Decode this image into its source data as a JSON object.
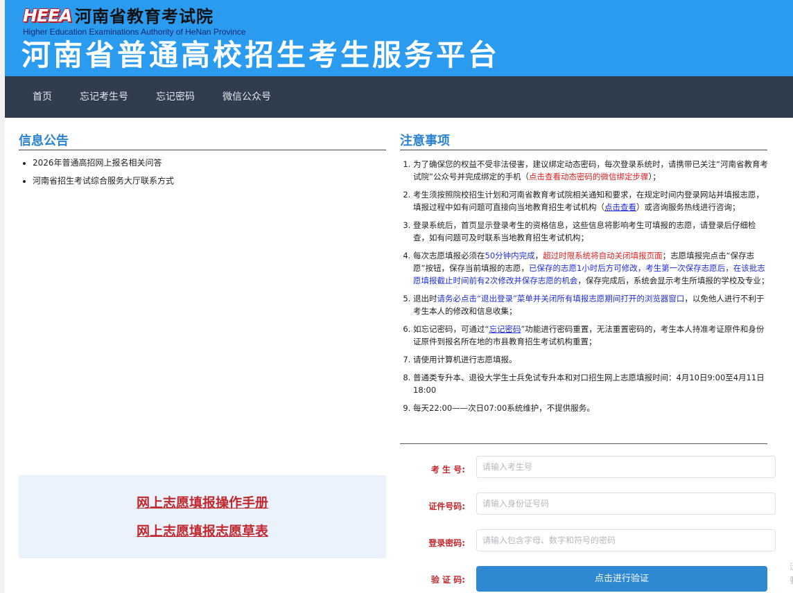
{
  "header": {
    "logo_text": "HEEA",
    "org_name_cn": "河南省教育考试院",
    "org_name_en": "Higher Education Examinations Authority of HeNan Province",
    "platform_title": "河南省普通高校招生考生服务平台"
  },
  "nav": {
    "items": [
      {
        "label": "首页"
      },
      {
        "label": "忘记考生号"
      },
      {
        "label": "忘记密码"
      },
      {
        "label": "微信公众号"
      }
    ]
  },
  "notices": {
    "title": "信息公告",
    "items": [
      {
        "label": "2026年普通高招网上报名相关问答"
      },
      {
        "label": "河南省招生考试综合服务大厅联系方式"
      }
    ]
  },
  "manuals": {
    "link1": "网上志愿填报操作手册",
    "link2": "网上志愿填报志愿草表"
  },
  "rules": {
    "title": "注意事项",
    "r1_a": "为了确保您的权益不受非法侵害，建议绑定动态密码，每次登录系统时，请携带已关注“河南省教育考试院”公众号并完成绑定的手机（",
    "r1_red": "点击查看动态密码的微信绑定步骤",
    "r1_b": "）；",
    "r2_a": "考生须按照院校招生计划和河南省教育考试院相关通知和要求，在规定时间内登录网站并填报志愿，填报过程中如有问题可直接向当地教育招生考试机构（",
    "r2_link": "点击查看",
    "r2_b": "）或咨询服务热线进行咨询；",
    "r3": "登录系统后，首页显示登录考生的资格信息，这些信息将影响考生可填报的志愿，请登录后仔细检查，如有问题可及时联系当地教育招生考试机构；",
    "r4_a": "每次志愿填报必须在",
    "r4_blue1": "50分钟内完成",
    "r4_b": "，",
    "r4_red": "超过时限系统将自动关闭填报页面",
    "r4_c": "；志愿填报完点击“保存志愿”按钮，保存当前填报的志愿，",
    "r4_blue2": "已保存的志愿1小时后方可修改，考生第一次保存志愿后，在该批志愿填报截止时间前有2次修改并保存志愿的机会",
    "r4_d": "，保存完成后，系统会显示考生所填报的学校及专业；",
    "r5_a": "退出时",
    "r5_blue": "请务必点击“退出登录”菜单并关闭所有填报志愿期间打开的浏览器窗口",
    "r5_b": "，以免他人进行不利于考生本人的修改和信息收集；",
    "r6_a": "如忘记密码，可通过“",
    "r6_link": "忘记密码",
    "r6_b": "”功能进行密码重置，无法重置密码的，考生本人持准考证原件和身份证原件到报名所在地的市县教育招生考试机构重置；",
    "r7": "请使用计算机进行志愿填报。",
    "r8": "普通类专升本、退役大学生士兵免试专升本和对口招生网上志愿填报时间：4月10日9:00至4月11日18:00",
    "r9": "每天22:00——次日07:00系统维护，不提供服务。"
  },
  "login": {
    "exam_no_label": "考 生 号:",
    "exam_no_placeholder": "请输入考生号",
    "id_label": "证件号码:",
    "id_placeholder": "请输入身份证号码",
    "password_label": "登录密码:",
    "password_placeholder": "请输入包含字母、数字和符号的密码",
    "captcha_label": "验 证 码:",
    "verify_button": "点击进行验证"
  },
  "edge_text": "泛 要"
}
